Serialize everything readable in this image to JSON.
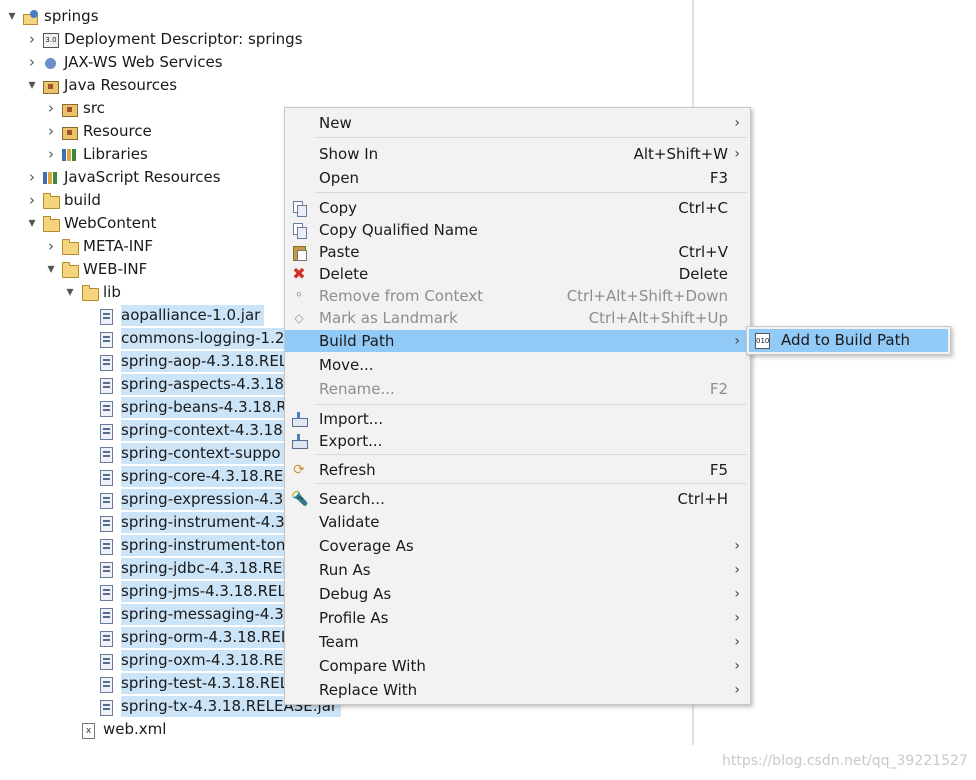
{
  "tree": {
    "items": [
      {
        "label": "springs",
        "icon": "project-icon",
        "expanded": true
      },
      {
        "label": "Deployment Descriptor: springs",
        "icon": "deployment-descriptor-icon",
        "expanded": false
      },
      {
        "label": "JAX-WS Web Services",
        "icon": "web-services-icon",
        "expanded": false
      },
      {
        "label": "Java Resources",
        "icon": "java-resources-icon",
        "expanded": true
      },
      {
        "label": "src",
        "icon": "package-folder-icon",
        "expanded": false
      },
      {
        "label": "Resource",
        "icon": "package-folder-icon",
        "expanded": false
      },
      {
        "label": "Libraries",
        "icon": "libraries-icon",
        "expanded": false
      },
      {
        "label": "JavaScript Resources",
        "icon": "javascript-resources-icon",
        "expanded": false
      },
      {
        "label": "build",
        "icon": "folder-icon",
        "expanded": false
      },
      {
        "label": "WebContent",
        "icon": "folder-icon",
        "expanded": true
      },
      {
        "label": "META-INF",
        "icon": "folder-icon",
        "expanded": false
      },
      {
        "label": "WEB-INF",
        "icon": "folder-icon",
        "expanded": true
      },
      {
        "label": "lib",
        "icon": "folder-icon",
        "expanded": true
      },
      {
        "label": "aopalliance-1.0.jar",
        "icon": "jar-icon"
      },
      {
        "label": "commons-logging-1.2",
        "icon": "jar-icon"
      },
      {
        "label": "spring-aop-4.3.18.REL",
        "icon": "jar-icon"
      },
      {
        "label": "spring-aspects-4.3.18.",
        "icon": "jar-icon"
      },
      {
        "label": "spring-beans-4.3.18.RI",
        "icon": "jar-icon"
      },
      {
        "label": "spring-context-4.3.18.",
        "icon": "jar-icon"
      },
      {
        "label": "spring-context-suppo",
        "icon": "jar-icon"
      },
      {
        "label": "spring-core-4.3.18.REL",
        "icon": "jar-icon"
      },
      {
        "label": "spring-expression-4.3.",
        "icon": "jar-icon"
      },
      {
        "label": "spring-instrument-4.3.",
        "icon": "jar-icon"
      },
      {
        "label": "spring-instrument-ton",
        "icon": "jar-icon"
      },
      {
        "label": "spring-jdbc-4.3.18.REL",
        "icon": "jar-icon"
      },
      {
        "label": "spring-jms-4.3.18.RELE",
        "icon": "jar-icon"
      },
      {
        "label": "spring-messaging-4.3.",
        "icon": "jar-icon"
      },
      {
        "label": "spring-orm-4.3.18.REL",
        "icon": "jar-icon"
      },
      {
        "label": "spring-oxm-4.3.18.REL",
        "icon": "jar-icon"
      },
      {
        "label": "spring-test-4.3.18.REL",
        "icon": "jar-icon"
      },
      {
        "label": "spring-tx-4.3.18.RELEASE.jar",
        "icon": "jar-icon"
      },
      {
        "label": "web.xml",
        "icon": "xml-file-icon"
      }
    ]
  },
  "menu": {
    "items": [
      {
        "label": "New",
        "shortcut": "",
        "submenu": true,
        "disabled": false
      },
      {
        "label": "Show In",
        "shortcut": "Alt+Shift+W",
        "submenu": true,
        "disabled": false
      },
      {
        "label": "Open",
        "shortcut": "F3",
        "submenu": false,
        "disabled": false
      },
      {
        "label": "Copy",
        "shortcut": "Ctrl+C",
        "submenu": false,
        "disabled": false,
        "icon": "copy-icon"
      },
      {
        "label": "Copy Qualified Name",
        "shortcut": "",
        "submenu": false,
        "disabled": false,
        "icon": "copy-qualified-name-icon"
      },
      {
        "label": "Paste",
        "shortcut": "Ctrl+V",
        "submenu": false,
        "disabled": false,
        "icon": "paste-icon"
      },
      {
        "label": "Delete",
        "shortcut": "Delete",
        "submenu": false,
        "disabled": false,
        "icon": "delete-icon"
      },
      {
        "label": "Remove from Context",
        "shortcut": "Ctrl+Alt+Shift+Down",
        "submenu": false,
        "disabled": true,
        "icon": "remove-from-context-icon"
      },
      {
        "label": "Mark as Landmark",
        "shortcut": "Ctrl+Alt+Shift+Up",
        "submenu": false,
        "disabled": true,
        "icon": "landmark-icon"
      },
      {
        "label": "Build Path",
        "shortcut": "",
        "submenu": true,
        "disabled": false,
        "highlighted": true
      },
      {
        "label": "Move...",
        "shortcut": "",
        "submenu": false,
        "disabled": false
      },
      {
        "label": "Rename...",
        "shortcut": "F2",
        "submenu": false,
        "disabled": true
      },
      {
        "label": "Import...",
        "shortcut": "",
        "submenu": false,
        "disabled": false,
        "icon": "import-icon"
      },
      {
        "label": "Export...",
        "shortcut": "",
        "submenu": false,
        "disabled": false,
        "icon": "export-icon"
      },
      {
        "label": "Refresh",
        "shortcut": "F5",
        "submenu": false,
        "disabled": false,
        "icon": "refresh-icon"
      },
      {
        "label": "Search...",
        "shortcut": "Ctrl+H",
        "submenu": false,
        "disabled": false,
        "icon": "search-icon"
      },
      {
        "label": "Validate",
        "shortcut": "",
        "submenu": false,
        "disabled": false
      },
      {
        "label": "Coverage As",
        "shortcut": "",
        "submenu": true,
        "disabled": false
      },
      {
        "label": "Run As",
        "shortcut": "",
        "submenu": true,
        "disabled": false
      },
      {
        "label": "Debug As",
        "shortcut": "",
        "submenu": true,
        "disabled": false
      },
      {
        "label": "Profile As",
        "shortcut": "",
        "submenu": true,
        "disabled": false
      },
      {
        "label": "Team",
        "shortcut": "",
        "submenu": true,
        "disabled": false
      },
      {
        "label": "Compare With",
        "shortcut": "",
        "submenu": true,
        "disabled": false
      },
      {
        "label": "Replace With",
        "shortcut": "",
        "submenu": true,
        "disabled": false
      }
    ],
    "arrow_glyph": "›"
  },
  "submenu": {
    "label": "Add to Build Path",
    "icon": "add-to-build-path-icon",
    "icon_text": "010"
  },
  "watermark": "https://blog.csdn.net/qq_39221527",
  "colors": {
    "highlight": "#91c9f7",
    "selection": "#cce4f7",
    "menu_bg": "#f2f2f2"
  }
}
